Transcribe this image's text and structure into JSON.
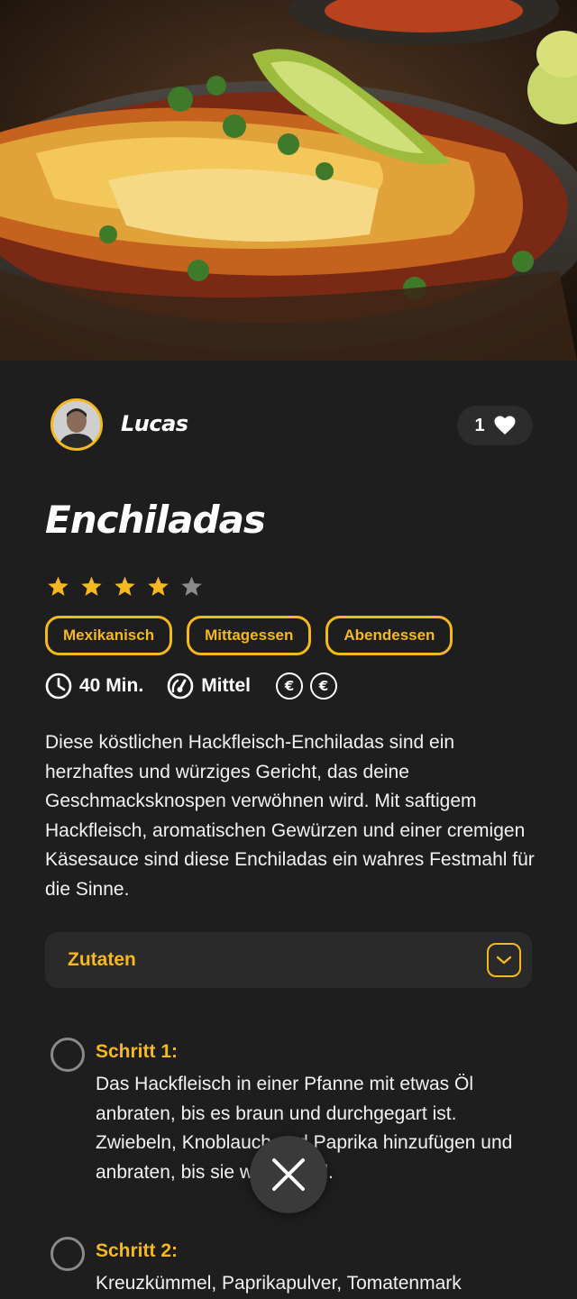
{
  "hero": {
    "image_name": "enchiladas-photo"
  },
  "author": {
    "name": "Lucas"
  },
  "likes": {
    "count": "1"
  },
  "recipe": {
    "title": "Enchiladas",
    "rating": 4,
    "rating_max": 5,
    "tags": [
      "Mexikanisch",
      "Mittagessen",
      "Abendessen"
    ],
    "time": "40 Min.",
    "difficulty": "Mittel",
    "cost_symbol": "€",
    "cost_level": 2,
    "description": "Diese köstlichen Hackfleisch-Enchiladas sind ein herzhaftes und würziges Gericht, das deine Geschmacksknospen verwöhnen wird. Mit saftigem Hackfleisch, aromatischen Gewürzen und einer cremigen Käsesauce sind diese Enchiladas ein wahres Festmahl für die Sinne."
  },
  "ingredients": {
    "label": "Zutaten"
  },
  "steps": [
    {
      "title": "Schritt 1:",
      "text": "Das Hackfleisch in einer Pfanne mit etwas Öl anbraten, bis es braun und durchgegart ist. Zwiebeln, Knoblauch und Paprika hinzufügen und anbraten, bis sie weich sind."
    },
    {
      "title": "Schritt 2:",
      "text": "Kreuzkümmel, Paprikapulver, Tomatenmark"
    }
  ],
  "icons": {
    "heart": "heart-icon",
    "star": "star-icon",
    "clock": "clock-icon",
    "gauge": "gauge-icon",
    "euro": "euro-icon",
    "chevron": "chevron-down-icon",
    "close": "close-icon"
  },
  "colors": {
    "accent": "#f5b81f",
    "background": "#1e1e1e",
    "star_inactive": "#8a8a8a"
  }
}
